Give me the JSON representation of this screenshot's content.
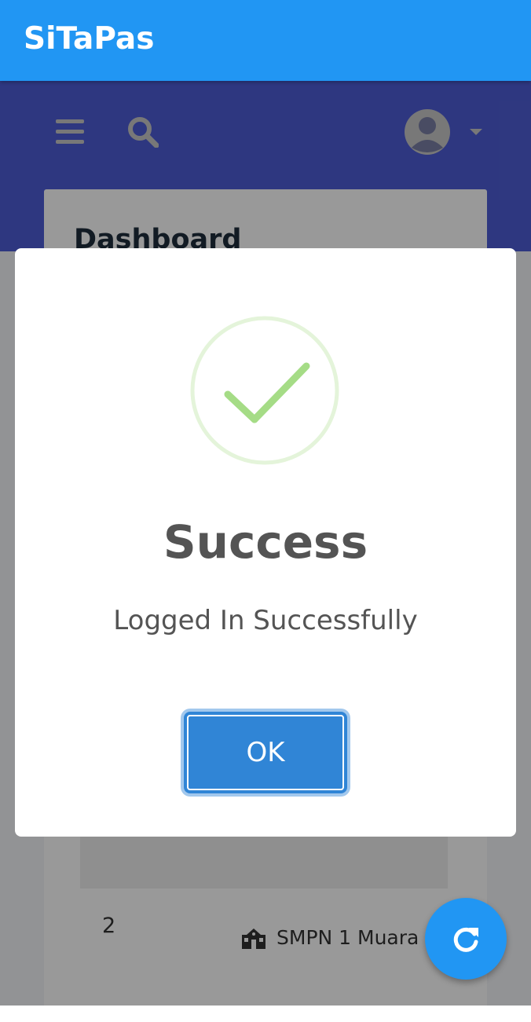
{
  "app": {
    "title": "SiTaPas"
  },
  "navbar": {
    "menu_icon": "hamburger-icon",
    "search_icon": "search-icon",
    "user_icon": "user-avatar-icon",
    "dropdown_icon": "caret-down-icon"
  },
  "dashboard": {
    "title": "Dashboard",
    "row": {
      "number": "2",
      "school_icon": "school-icon",
      "school_name": "SMPN 1 Muara"
    }
  },
  "modal": {
    "icon": "success-check-icon",
    "title": "Success",
    "message": "Logged In Successfully",
    "ok_label": "OK"
  },
  "fab": {
    "icon": "refresh-icon"
  },
  "colors": {
    "app_bar": "#2196f3",
    "nav_band": "#4e5dd6",
    "ok_button": "#3085d6",
    "success_green": "#a5dc86"
  }
}
